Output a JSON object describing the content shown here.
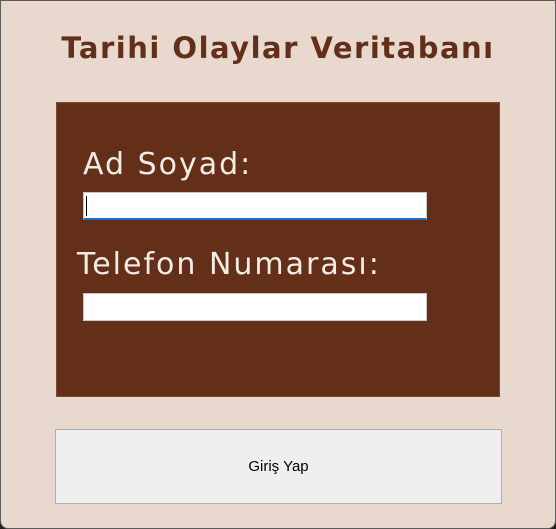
{
  "app": {
    "title": "Tarihi Olaylar Veritabanı"
  },
  "form": {
    "name_label": "Ad Soyad:",
    "name_value": "",
    "phone_label": "Telefon Numarası:",
    "phone_value": ""
  },
  "actions": {
    "login_label": "Giriş Yap"
  },
  "colors": {
    "background": "#e8d8ce",
    "panel": "#632f18",
    "title_text": "#62301a",
    "label_text": "#f3ece6",
    "focus_accent": "#1a6fc2"
  }
}
